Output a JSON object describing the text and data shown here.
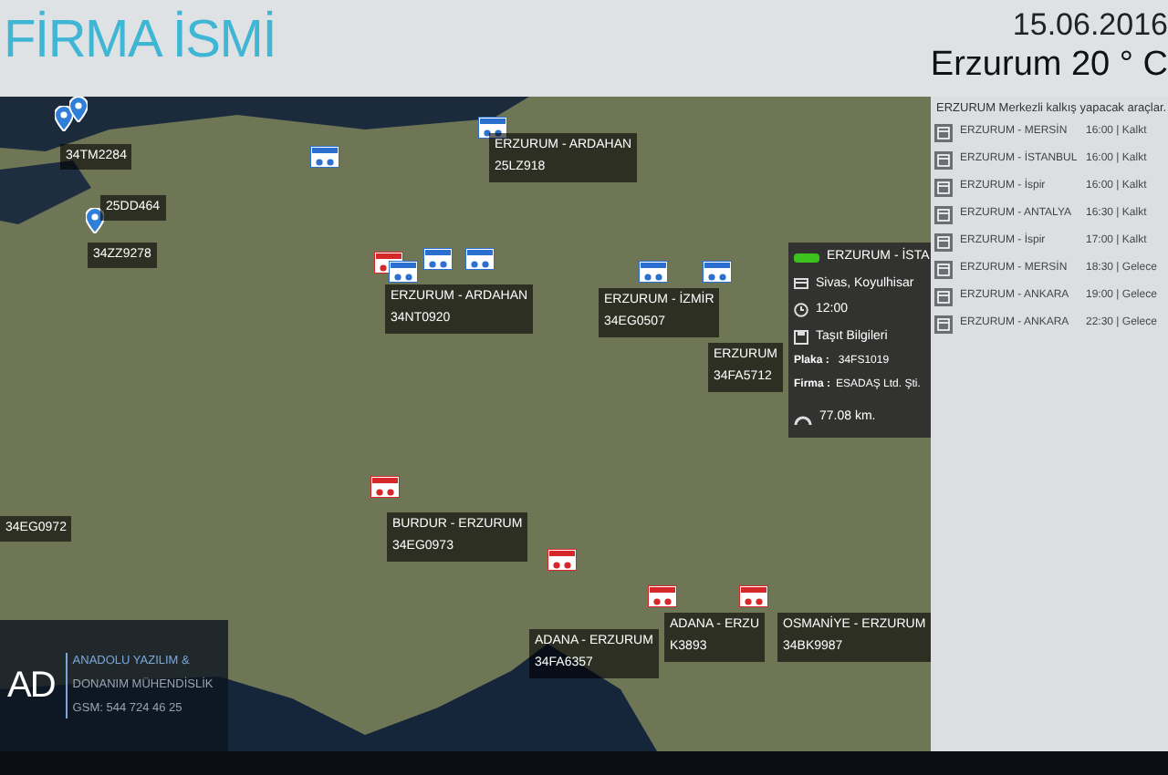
{
  "header": {
    "title": "FİRMA İSMİ",
    "date": "15.06.2016",
    "weather": "Erzurum 20 ° C"
  },
  "map": {
    "pins": [
      {
        "color": "#2f7fd8"
      },
      {
        "color": "#2f7fd8"
      },
      {
        "color": "#2f7fd8"
      }
    ],
    "markers": [
      {
        "color": "#2b6fd0"
      },
      {
        "color": "#2b6fd0"
      },
      {
        "color": "#d62828"
      },
      {
        "color": "#2b6fd0"
      },
      {
        "color": "#2b6fd0"
      },
      {
        "color": "#2b6fd0"
      },
      {
        "color": "#2b6fd0"
      },
      {
        "color": "#2b6fd0"
      },
      {
        "color": "#d62828"
      },
      {
        "color": "#d62828"
      },
      {
        "color": "#d62828"
      },
      {
        "color": "#d62828"
      }
    ],
    "labels": [
      {
        "plate": "34TM2284"
      },
      {
        "plate": "25DD464"
      },
      {
        "plate": "34ZZ9278"
      },
      {
        "route": "ERZURUM - ARDAHAN",
        "plate": "25LZ918"
      },
      {
        "route": "ERZURUM - ARDAHAN",
        "plate": "34NT0920"
      },
      {
        "route": "ERZURUM - İZMİR",
        "plate": "34EG0507"
      },
      {
        "route": "ERZURUM",
        "plate": "34FA5712"
      },
      {
        "plate": "34EG0972"
      },
      {
        "route": "BURDUR - ERZURUM",
        "plate": "34EG0973"
      },
      {
        "route": "ADANA - ERZURUM",
        "plate": "34FA6357"
      },
      {
        "route": "ADANA - ERZU",
        "plate": "K3893"
      },
      {
        "route": "OSMANİYE - ERZURUM",
        "plate": "34BK9987"
      }
    ],
    "popup": {
      "route": "ERZURUM - İSTA",
      "location": "Sivas, Koyulhisar",
      "time": "12:00",
      "info_title": "Taşıt Bilgileri",
      "plate_label": "Plaka :",
      "plate": "34FS1019",
      "company_label": "Firma :",
      "company": "ESADAŞ Ltd. Şti.",
      "distance": "77.08 km."
    },
    "company": {
      "logo": "AD",
      "name_line_1": "ANADOLU YAZILIM &",
      "name_line_2": "DONANIM MÜHENDİSLİK",
      "phone": "GSM: 544 724 46 25"
    }
  },
  "departures": {
    "title": "ERZURUM Merkezli kalkış yapacak araçlar.",
    "rows": [
      {
        "route": "ERZURUM -  MERSİN",
        "status": "16:00 | Kalkt"
      },
      {
        "route": "ERZURUM -  İSTANBUL",
        "status": "16:00 | Kalkt"
      },
      {
        "route": "ERZURUM -  İspir",
        "status": "16:00 | Kalkt"
      },
      {
        "route": "ERZURUM -  ANTALYA",
        "status": "16:30 | Kalkt"
      },
      {
        "route": "ERZURUM -  İspir",
        "status": "17:00 | Kalkt"
      },
      {
        "route": "ERZURUM -  MERSİN",
        "status": "18:30 | Gelece"
      },
      {
        "route": "ERZURUM -  ANKARA",
        "status": "19:00 | Gelece"
      },
      {
        "route": "ERZURUM -  ANKARA",
        "status": "22:30 | Gelece"
      }
    ]
  }
}
